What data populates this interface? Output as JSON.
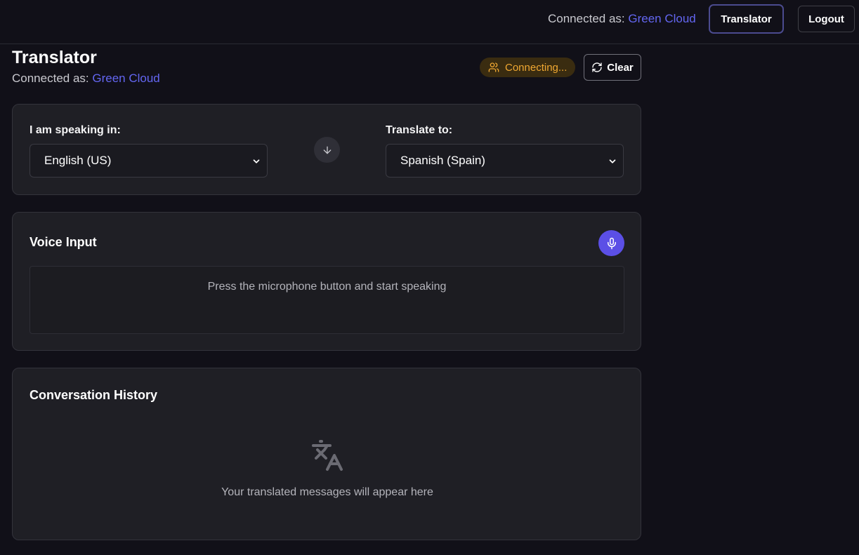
{
  "header": {
    "connected_prefix": "Connected as:",
    "user_name": "Green Cloud",
    "nav_translator": "Translator",
    "nav_logout": "Logout"
  },
  "page": {
    "title": "Translator",
    "connected_prefix": "Connected as:",
    "user_name": "Green Cloud",
    "status": "Connecting...",
    "clear_label": "Clear"
  },
  "languages": {
    "source_label": "I am speaking in:",
    "source_value": "English (US)",
    "target_label": "Translate to:",
    "target_value": "Spanish (Spain)"
  },
  "voice": {
    "title": "Voice Input",
    "placeholder": "Press the microphone button and start speaking"
  },
  "history": {
    "title": "Conversation History",
    "empty_text": "Your translated messages will appear here"
  },
  "colors": {
    "accent": "#6366f1",
    "mic": "#5b4fe6",
    "status_text": "#f0a832",
    "status_bg": "#3a2c10",
    "background": "#111018",
    "card": "#1f1f25"
  },
  "icons": {
    "status": "users-icon",
    "clear": "refresh-icon",
    "swap": "arrow-down-icon",
    "mic": "microphone-icon",
    "history": "translate-icon",
    "select": "chevron-down-icon"
  }
}
